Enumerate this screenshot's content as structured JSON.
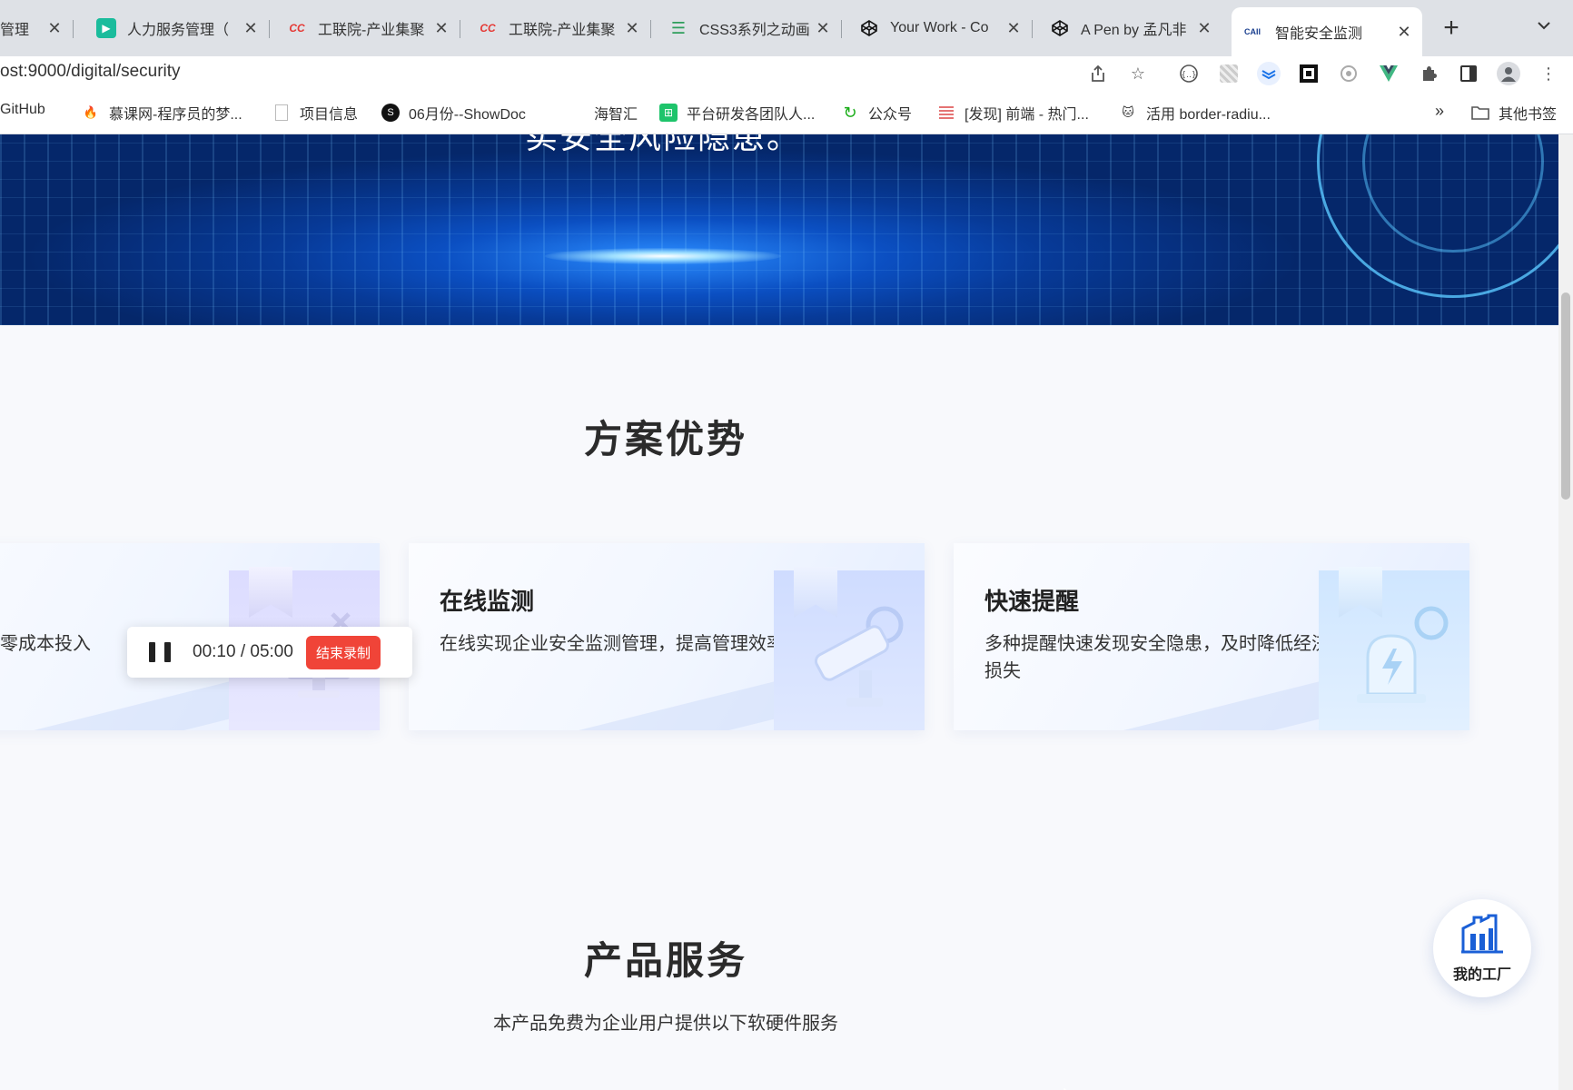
{
  "tabs": [
    {
      "title": "管理",
      "favicon": "blank"
    },
    {
      "title": "人力服务管理（",
      "favicon": "green-play"
    },
    {
      "title": "工联院-产业集聚",
      "favicon": "cc-red"
    },
    {
      "title": "工联院-产业集聚",
      "favicon": "cc-red"
    },
    {
      "title": "CSS3系列之动画",
      "favicon": "green-lines"
    },
    {
      "title": "Your Work - Co",
      "favicon": "codepen"
    },
    {
      "title": "A Pen by 孟凡非",
      "favicon": "codepen"
    },
    {
      "title": "智能安全监测",
      "favicon": "caii",
      "active": true
    }
  ],
  "new_tab": "+",
  "tab_menu": "⌄",
  "url": "ost:9000/digital/security",
  "bookmarks": [
    {
      "label": "GitHub",
      "icon": "github"
    },
    {
      "label": "慕课网-程序员的梦...",
      "icon": "flame"
    },
    {
      "label": "项目信息",
      "icon": "page"
    },
    {
      "label": "06月份--ShowDoc",
      "icon": "showdoc"
    },
    {
      "label": "海智汇",
      "icon": "none"
    },
    {
      "label": "平台研发各团队人...",
      "icon": "sheet"
    },
    {
      "label": "公众号",
      "icon": "loop"
    },
    {
      "label": "[发现] 前端 - 热门...",
      "icon": "page-stripe"
    },
    {
      "label": "活用 border-radiu...",
      "icon": "cat"
    }
  ],
  "bookmarks_more": "»",
  "other_bookmarks": "其他书签",
  "banner_text": "实安全风险隐患。",
  "section1_title": "方案优势",
  "cards": [
    {
      "title": "",
      "desc": "零成本投入",
      "art": "monitor"
    },
    {
      "title": "在线监测",
      "desc": "在线实现企业安全监测管理，提高管理效率",
      "art": "camera"
    },
    {
      "title": "快速提醒",
      "desc": "多种提醒快速发现安全隐患，及时降低经济损失",
      "art": "alarm"
    }
  ],
  "recorder": {
    "elapsed": "00:10",
    "separator": "/",
    "total": "05:00",
    "stop_label": "结束录制"
  },
  "section2_title": "产品服务",
  "section2_subtitle": "本产品免费为企业用户提供以下软硬件服务",
  "fab_label": "我的工厂",
  "colors": {
    "accent": "#1a5fd6",
    "stop_button": "#f04438",
    "banner_dark": "#05276a"
  }
}
